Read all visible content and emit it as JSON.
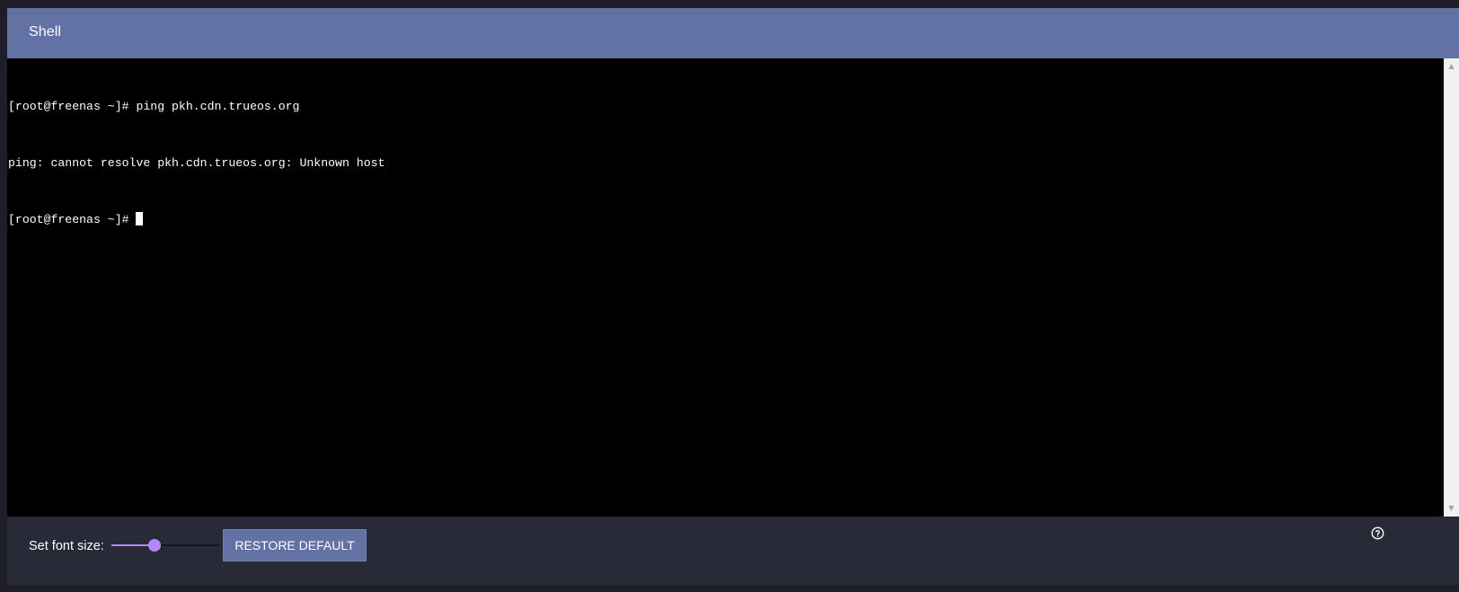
{
  "header": {
    "title": "Shell"
  },
  "terminal": {
    "lines": [
      "[root@freenas ~]# ping pkh.cdn.trueos.org",
      "ping: cannot resolve pkh.cdn.trueos.org: Unknown host",
      "[root@freenas ~]# "
    ]
  },
  "footer": {
    "font_size_label": "Set font size:",
    "font_size_slider_fraction": 0.4,
    "restore_button_label": "RESTORE DEFAULT",
    "help_icon": "help-circle-icon"
  },
  "colors": {
    "header_bg": "#6272a4",
    "terminal_bg": "#000000",
    "panel_bg": "#282a37",
    "slider_accent": "#b388ff",
    "button_bg": "#6272a4"
  }
}
